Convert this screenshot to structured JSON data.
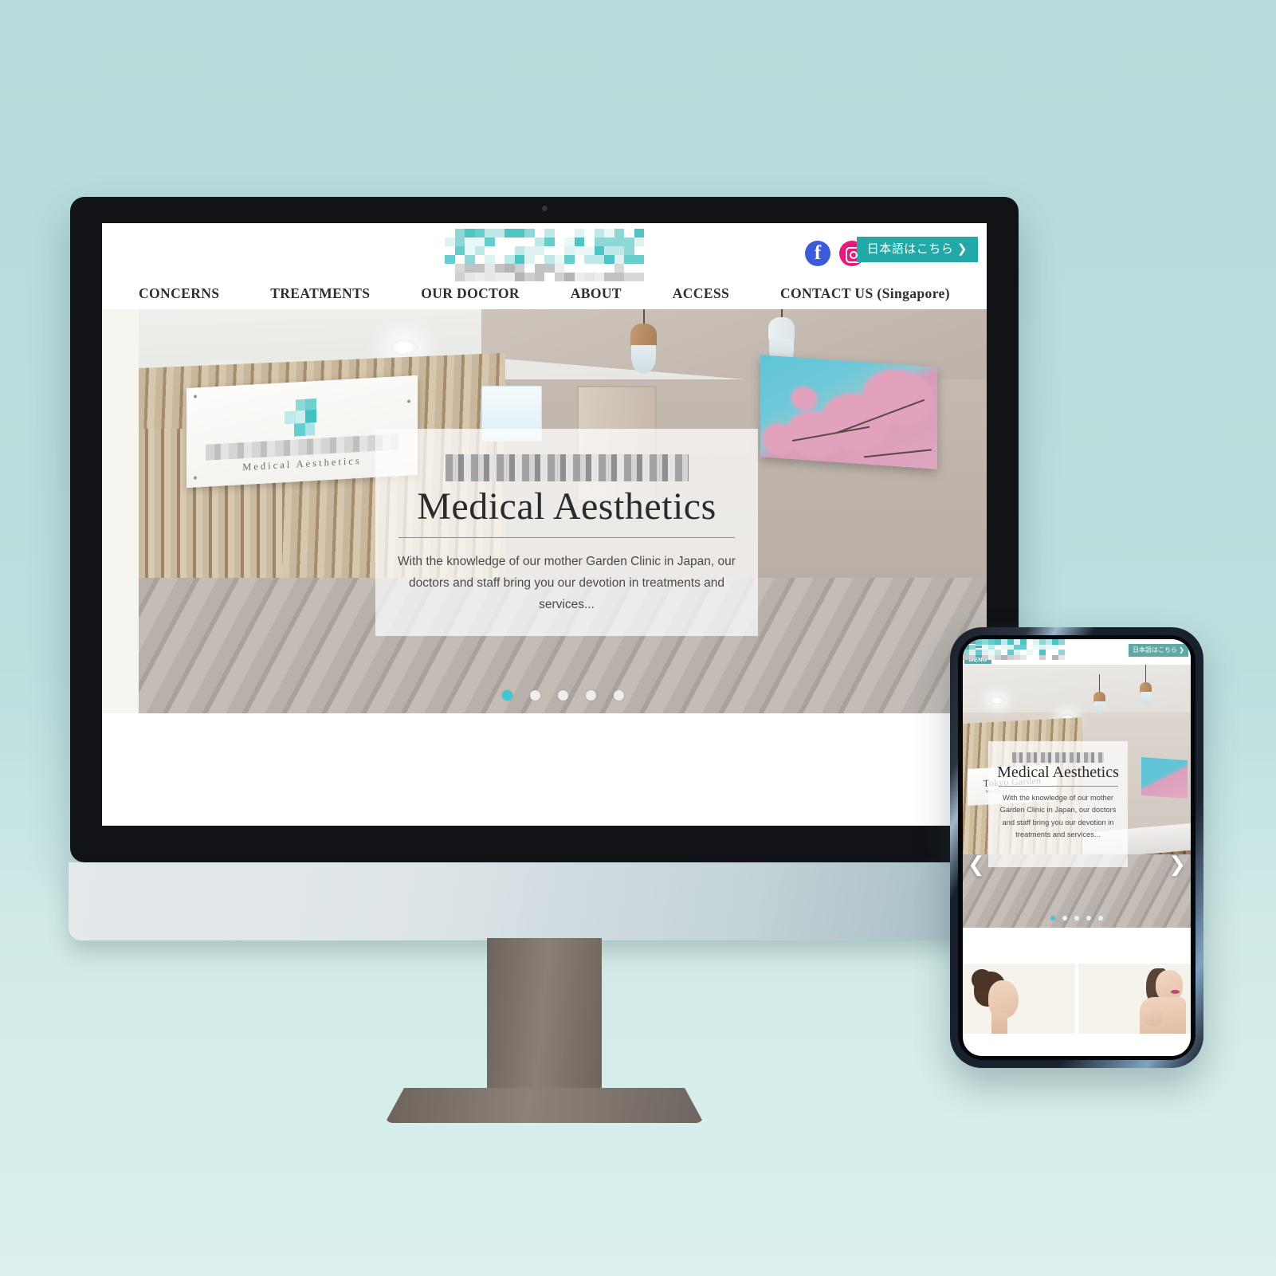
{
  "page": {
    "background_color": "#b5dbda",
    "accent_teal": "#22a8a6",
    "dot_active_color": "#3fc8d4"
  },
  "desktop": {
    "header": {
      "logo_alt": "pixelated-clinic-logo",
      "social": [
        {
          "name": "facebook",
          "glyph": "f",
          "color": "#3b5bdb"
        },
        {
          "name": "instagram",
          "glyph": "camera",
          "color": "#e6197f"
        }
      ],
      "language_button": "日本語はこちら ❯"
    },
    "nav": [
      {
        "label": "CONCERNS"
      },
      {
        "label": "TREATMENTS"
      },
      {
        "label": "OUR DOCTOR"
      },
      {
        "label": "ABOUT"
      },
      {
        "label": "ACCESS"
      },
      {
        "label": "CONTACT US (Singapore)"
      }
    ],
    "hero": {
      "sign_subtitle": "Medical Aesthetics",
      "blurred_brand": "",
      "title": "Medical Aesthetics",
      "subtitle": "With the knowledge of our mother Garden Clinic in Japan, our doctors and staff bring you our devotion in treatments and services...",
      "carousel": {
        "total": 5,
        "active_index": 1
      }
    }
  },
  "mobile": {
    "header": {
      "menu_label": "MENU",
      "logo_alt": "pixelated-clinic-logo",
      "language_button": "日本語はこちら ❯"
    },
    "hero": {
      "sign_line1": "Tokyo Garden",
      "sign_line2": "Medical Aesthetics",
      "title": "Medical Aesthetics",
      "subtitle": "With the knowledge of our mother Garden Clinic in Japan, our doctors and staff bring you our devotion in treatments and services...",
      "prev_arrow": "❮",
      "next_arrow": "❯",
      "carousel": {
        "total": 5,
        "active_index": 1
      }
    },
    "thumbnails": [
      {
        "name": "facial-treatment-thumb"
      },
      {
        "name": "underarm-treatment-thumb"
      }
    ]
  }
}
